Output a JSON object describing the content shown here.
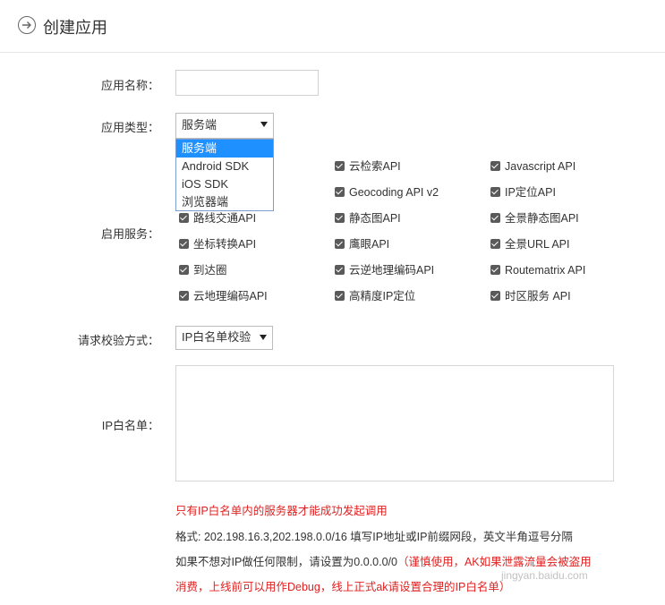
{
  "header": {
    "title": "创建应用"
  },
  "form": {
    "app_name_label": "应用名称：",
    "app_name_value": "",
    "app_type_label": "应用类型：",
    "app_type_value": "服务端",
    "app_type_options": [
      "服务端",
      "Android SDK",
      "iOS SDK",
      "浏览器端"
    ],
    "services_label": "启用服务：",
    "services": [
      {
        "label": "云检索API",
        "checked": true
      },
      {
        "label": "Javascript API",
        "checked": true
      },
      {
        "label": "Geocoding API v2",
        "checked": true
      },
      {
        "label": "IP定位API",
        "checked": true
      },
      {
        "label": "路线交通API",
        "checked": true
      },
      {
        "label": "静态图API",
        "checked": true
      },
      {
        "label": "全景静态图API",
        "checked": true
      },
      {
        "label": "坐标转换API",
        "checked": true
      },
      {
        "label": "鹰眼API",
        "checked": true
      },
      {
        "label": "全景URL API",
        "checked": true
      },
      {
        "label": "到达圈",
        "checked": true
      },
      {
        "label": "云逆地理编码API",
        "checked": true
      },
      {
        "label": "Routematrix API",
        "checked": true
      },
      {
        "label": "云地理编码API",
        "checked": true
      },
      {
        "label": "高精度IP定位",
        "checked": true
      },
      {
        "label": "时区服务 API",
        "checked": true
      }
    ],
    "verify_label": "请求校验方式：",
    "verify_value": "IP白名单校验",
    "whitelist_label": "IP白名单：",
    "whitelist_value": ""
  },
  "notes": {
    "line1": "只有IP白名单内的服务器才能成功发起调用",
    "line2": "格式: 202.198.16.3,202.198.0.0/16 填写IP地址或IP前缀网段，英文半角逗号分隔",
    "line3a": "如果不想对IP做任何限制，请设置为0.0.0.0/0",
    "line3b": "（谨慎使用，AK如果泄露流量会被盗用",
    "line4": "消费，上线前可以用作Debug，线上正式ak请设置合理的IP白名单）"
  },
  "watermark": "jingyan.baidu.com",
  "colors": {
    "red": "#e02020",
    "selected_option_bg": "#1e90ff"
  }
}
